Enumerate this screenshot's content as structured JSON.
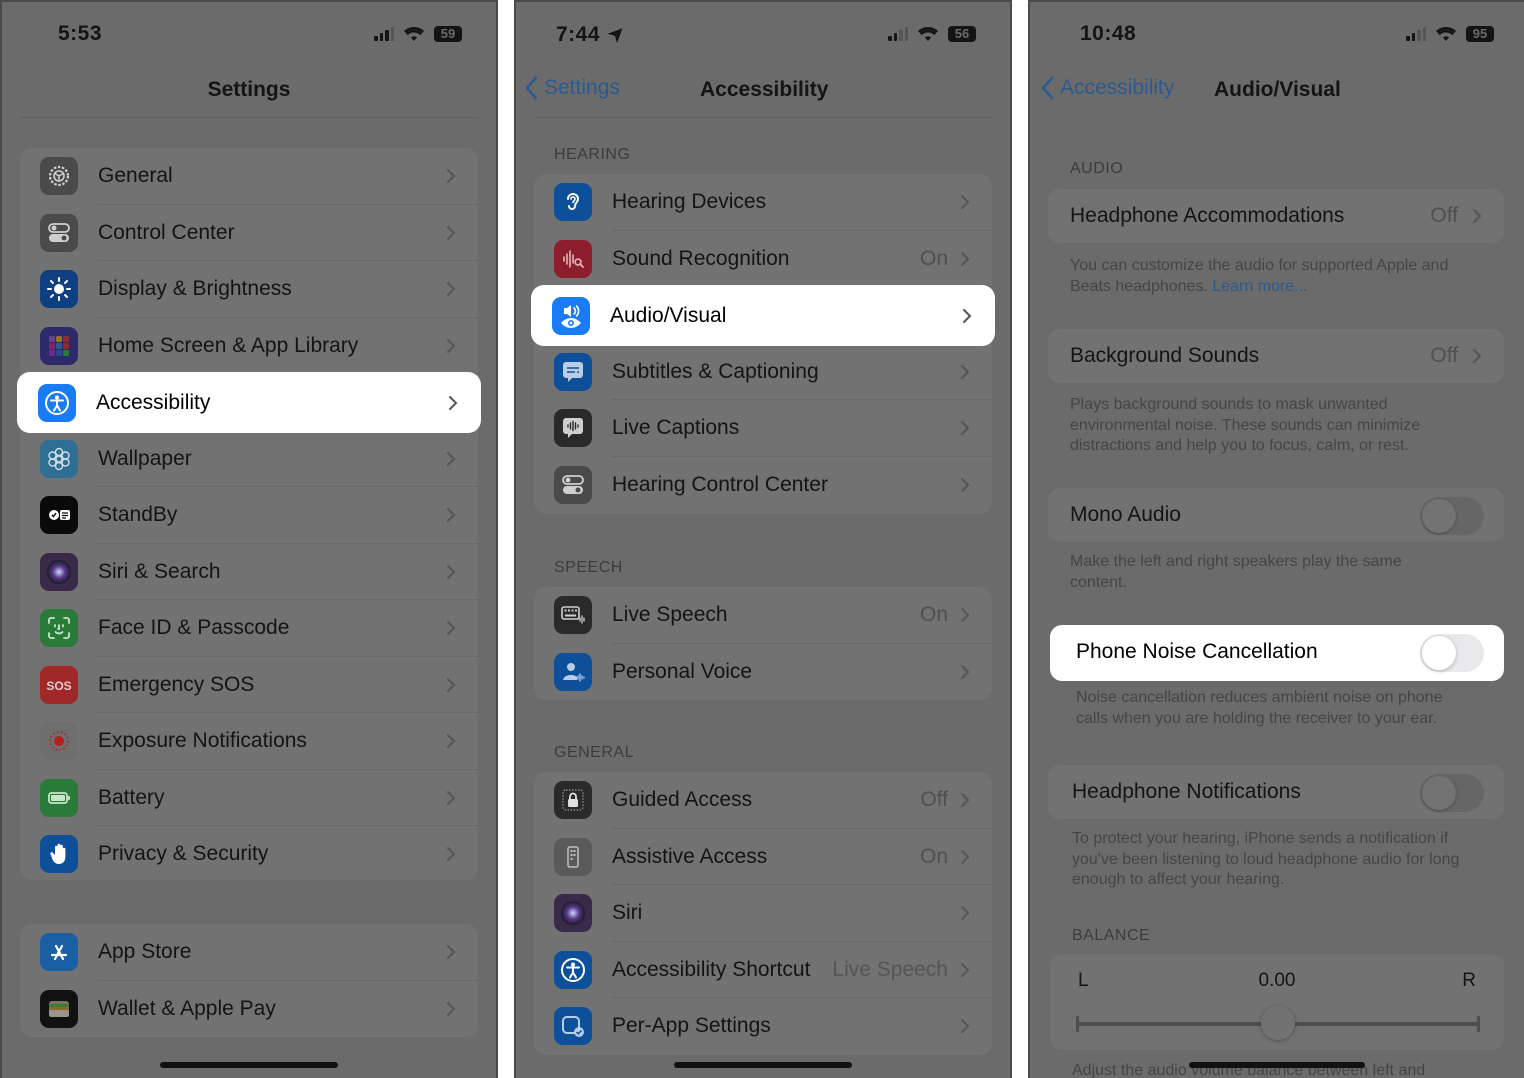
{
  "panels": [
    {
      "status": {
        "time": "5:53",
        "battery": "59",
        "location_arrow": false
      },
      "nav": {
        "title": "Settings",
        "back": null
      },
      "groups": [
        {
          "items": [
            {
              "label": "General",
              "icon": "gear-icon",
              "color": "#4a4a4a"
            },
            {
              "label": "Control Center",
              "icon": "toggles-icon",
              "color": "#4a4a4a"
            },
            {
              "label": "Display & Brightness",
              "icon": "sun-icon",
              "color": "#0e3f80"
            },
            {
              "label": "Home Screen & App Library",
              "icon": "app-grid-icon",
              "color": "#2c2a6b"
            },
            {
              "label": "Accessibility",
              "icon": "accessibility-icon",
              "color": "#1a7cf5",
              "highlighted": true
            },
            {
              "label": "Wallpaper",
              "icon": "flower-icon",
              "color": "#2f6e93"
            },
            {
              "label": "StandBy",
              "icon": "standby-icon",
              "color": "#0a0a0a"
            },
            {
              "label": "Siri & Search",
              "icon": "siri-icon",
              "color": "#3a2a4a"
            },
            {
              "label": "Face ID & Passcode",
              "icon": "face-id-icon",
              "color": "#2a7a3a"
            },
            {
              "label": "Emergency SOS",
              "icon": "sos-icon",
              "color": "#a02828"
            },
            {
              "label": "Exposure Notifications",
              "icon": "exposure-icon",
              "color": "#6e6e6e"
            },
            {
              "label": "Battery",
              "icon": "battery-icon",
              "color": "#2a7a3a"
            },
            {
              "label": "Privacy & Security",
              "icon": "hand-icon",
              "color": "#0e4f9a"
            }
          ]
        },
        {
          "items": [
            {
              "label": "App Store",
              "icon": "app-store-icon",
              "color": "#1a5fa3"
            },
            {
              "label": "Wallet & Apple Pay",
              "icon": "wallet-icon",
              "color": "#111111"
            }
          ]
        }
      ]
    },
    {
      "status": {
        "time": "7:44",
        "battery": "56",
        "location_arrow": true
      },
      "nav": {
        "title": "Accessibility",
        "back": "Settings"
      },
      "sections": [
        {
          "header": "HEARING",
          "items": [
            {
              "label": "Hearing Devices",
              "icon": "ear-icon",
              "color": "#0e4f9a",
              "value": ""
            },
            {
              "label": "Sound Recognition",
              "icon": "sound-recognition-icon",
              "color": "#8c1e2e",
              "value": "On"
            },
            {
              "label": "Audio/Visual",
              "icon": "audio-visual-icon",
              "color": "#1a7cf5",
              "value": "",
              "highlighted": true
            },
            {
              "label": "Subtitles & Captioning",
              "icon": "captions-icon",
              "color": "#0e4f9a",
              "value": ""
            },
            {
              "label": "Live Captions",
              "icon": "live-captions-icon",
              "color": "#2a2a2a",
              "value": ""
            },
            {
              "label": "Hearing Control Center",
              "icon": "toggles-icon",
              "color": "#4a4a4a",
              "value": ""
            }
          ]
        },
        {
          "header": "SPEECH",
          "items": [
            {
              "label": "Live Speech",
              "icon": "keyboard-icon",
              "color": "#2a2a2a",
              "value": "On"
            },
            {
              "label": "Personal Voice",
              "icon": "person-wave-icon",
              "color": "#0e4f9a",
              "value": ""
            }
          ]
        },
        {
          "header": "GENERAL",
          "items": [
            {
              "label": "Guided Access",
              "icon": "lock-icon",
              "color": "#2a2a2a",
              "value": "Off"
            },
            {
              "label": "Assistive Access",
              "icon": "assistive-icon",
              "color": "#5a5a5a",
              "value": "On"
            },
            {
              "label": "Siri",
              "icon": "siri-icon",
              "color": "#3a2a4a",
              "value": ""
            },
            {
              "label": "Accessibility Shortcut",
              "icon": "accessibility-icon",
              "color": "#0e4f9a",
              "value": "Live Speech"
            },
            {
              "label": "Per-App Settings",
              "icon": "per-app-icon",
              "color": "#0e4f9a",
              "value": ""
            }
          ]
        }
      ]
    },
    {
      "status": {
        "time": "10:48",
        "battery": "95",
        "location_arrow": false
      },
      "nav": {
        "title": "Audio/Visual",
        "back": "Accessibility"
      },
      "audio_header": "AUDIO",
      "headphone_accommodations": {
        "label": "Headphone Accommodations",
        "value": "Off",
        "footer": "You can customize the audio for supported Apple and Beats headphones.",
        "link": "Learn more..."
      },
      "background_sounds": {
        "label": "Background Sounds",
        "value": "Off",
        "footer": "Plays background sounds to mask unwanted environmental noise. These sounds can minimize distractions and help you to focus, calm, or rest."
      },
      "mono_audio": {
        "label": "Mono Audio",
        "on": false,
        "footer": "Make the left and right speakers play the same content."
      },
      "phone_noise_cancellation": {
        "label": "Phone Noise Cancellation",
        "on": false,
        "highlighted": true,
        "footer": "Noise cancellation reduces ambient noise on phone calls when you are holding the receiver to your ear."
      },
      "headphone_notifications": {
        "label": "Headphone Notifications",
        "on": false,
        "footer": "To protect your hearing, iPhone sends a notification if you've been listening to loud headphone audio for long enough to affect your hearing."
      },
      "balance": {
        "header": "BALANCE",
        "left": "L",
        "right": "R",
        "value": "0.00",
        "position_fraction": 0.5,
        "footer": "Adjust the audio volume balance between left and"
      }
    }
  ],
  "colors": {
    "accent_blue": "#1a7cf5",
    "highlight_bg": "#ffffff",
    "dim_bg": "#6b6b6b"
  }
}
